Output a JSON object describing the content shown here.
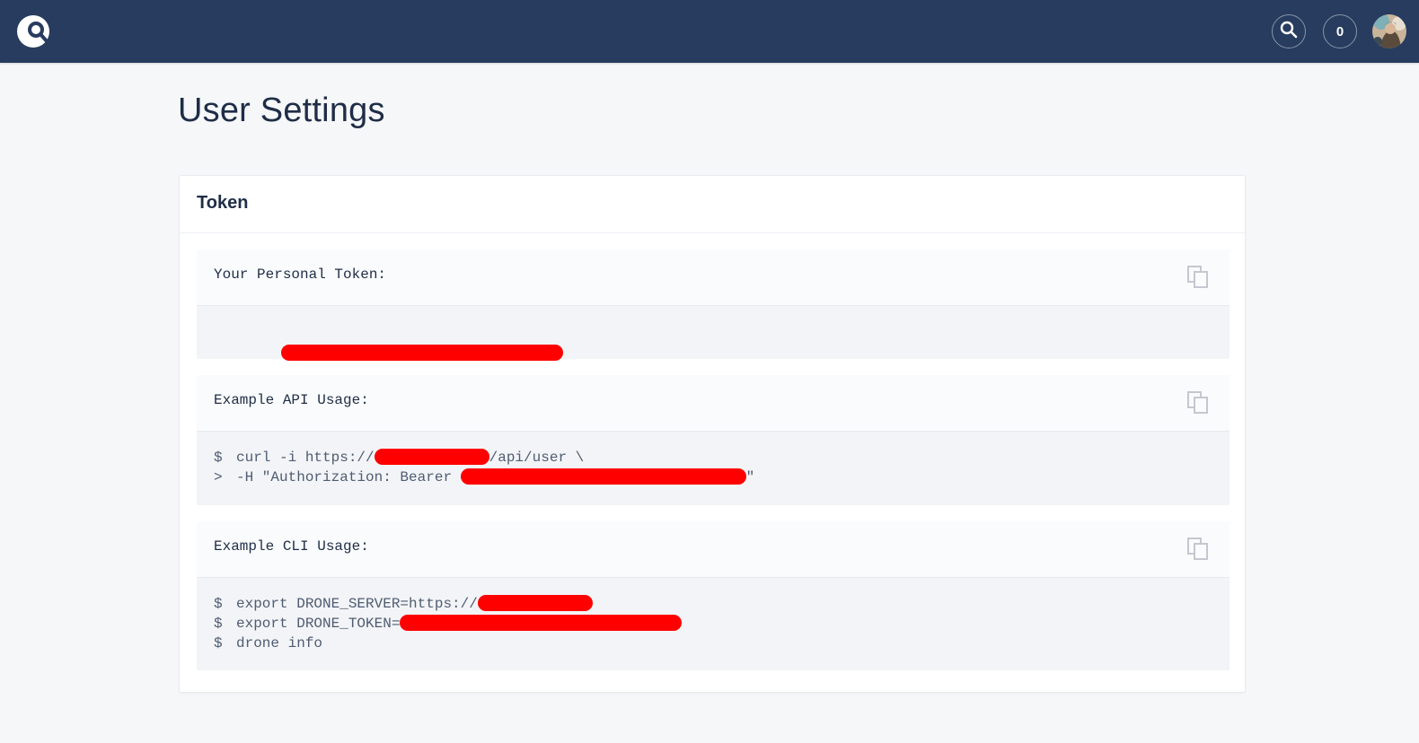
{
  "topbar": {
    "notification_count": "0",
    "icons": {
      "logo": "drone-logo-icon",
      "search": "search-icon",
      "avatar": "user-avatar"
    },
    "colors": {
      "background": "#273c5f"
    }
  },
  "page": {
    "title": "User Settings"
  },
  "card": {
    "title": "Token",
    "token_block": {
      "label": "Your Personal Token:"
    },
    "api_block": {
      "label": "Example API Usage:",
      "lines": [
        {
          "prompt": "$",
          "before": "curl -i https://",
          "after": "/api/user \\"
        },
        {
          "prompt": ">",
          "before": "-H \"Authorization: Bearer ",
          "after": "\""
        }
      ]
    },
    "cli_block": {
      "label": "Example CLI Usage:",
      "lines": [
        {
          "prompt": "$",
          "before": "export DRONE_SERVER=https://",
          "after": ""
        },
        {
          "prompt": "$",
          "before": "export DRONE_TOKEN=",
          "after": ""
        },
        {
          "prompt": "$",
          "before": "drone info",
          "after": ""
        }
      ]
    }
  },
  "redaction_color": "#ff0000"
}
